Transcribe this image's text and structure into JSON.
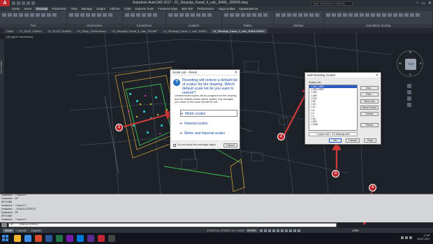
{
  "titlebar": {
    "app_button": "A",
    "title": "Autodesk AutoCAD 2017 - 01_Situacija_Kanal_4_calc_RARL_DN500.dwg",
    "search_placeholder": "Type a keyword or phrase",
    "window_controls": [
      "–",
      "▭",
      "✕"
    ]
  },
  "ribbon_tabs": [
    "Home",
    "Insert",
    "Annotate",
    "Parametric",
    "View",
    "Manage",
    "Output",
    "Add-ins",
    "A360",
    "Express Tools",
    "Featured Apps",
    "BIM 360",
    "Performance",
    "Надстройки",
    "Кармалинсон"
  ],
  "active_ribbon_tab": "Annotate",
  "ribbon_panels": [
    "Text",
    "Dimensions",
    "Centerlines",
    "Leaders",
    "Tables",
    "Markup",
    "Annotation Scaling"
  ],
  "doc_tabs": [
    "Start",
    "T1_SLUZ_KANAL",
    "01_SLUZ_Grafikiri",
    "01_Sliwy_Oshiarshnan",
    "01_Situacija_Kanal_4_calc_TOLBIP",
    "01_Situacija_Kanal_4_calc_RARLI",
    "01_Situacija_Kanal_4_calc_RARLDN500"
  ],
  "active_doc_tab": 6,
  "viewport": {
    "label": "[-][Top][2D Wireframe]",
    "side_palette_label": "Tool Palettes",
    "viewcube_label": "TOP",
    "compass": {
      "n": "N",
      "s": "S",
      "e": "E",
      "w": "W"
    }
  },
  "reset_dialog": {
    "title": "Scale List - Reset",
    "question": "Resetting will restore a default list of scales for the drawing. Which default scale list do you want to restore?",
    "note": "Unreferenced scales will be purged from the drawing and the default scales will be added. Any changes you made to the scale list will be lost.",
    "options": [
      "Metric scales",
      "Imperial scales",
      "Metric and Imperial scales"
    ],
    "selected_option": 0,
    "checkbox_label": "Do not show this message again",
    "cancel": "Cancel"
  },
  "scale_dialog": {
    "title": "Edit Drawing Scales",
    "list_label": "Scale List",
    "items": [
      "1:250_XREF",
      "1:250_XREF",
      "1:200",
      "1:250",
      "1:100",
      "1:50",
      "1:20",
      "1:10",
      "1:5",
      "1:2",
      "1:1",
      "1:25",
      "1:500",
      "1:1000"
    ],
    "selected_index": 0,
    "buttons": [
      "Add...",
      "Edit...",
      "Move Up",
      "Move Down",
      "Delete",
      "Reset"
    ],
    "info": "1 paper unit = 2.5 drawing units",
    "ok": "OK",
    "cancel": "Cancel",
    "help": "Help"
  },
  "markers": [
    "1",
    "2",
    "3",
    "4"
  ],
  "command_history": [
    "Command: *Cancel*",
    "Command: OP",
    "OPTIONS",
    "Command: *Cancel*",
    "Command: _SCALELISTEDIT",
    "Command: OP",
    "OPTIONS",
    "Command: *Cancel*"
  ],
  "command_input": "SC - _SCALELISTEDIT",
  "statusbar": {
    "layout_tabs": [
      "Model",
      "Layout1",
      "Layout2"
    ],
    "coordinates": "479923.34, 4790017.02, 0.0000",
    "model_label": "MODEL",
    "scale": "1:250"
  },
  "taskbar": {
    "time": "17:57",
    "date": "15.07.2017"
  },
  "colors": {
    "accent": "#c0262d",
    "link": "#1a4aa0",
    "selection": "#2a5cc7"
  }
}
